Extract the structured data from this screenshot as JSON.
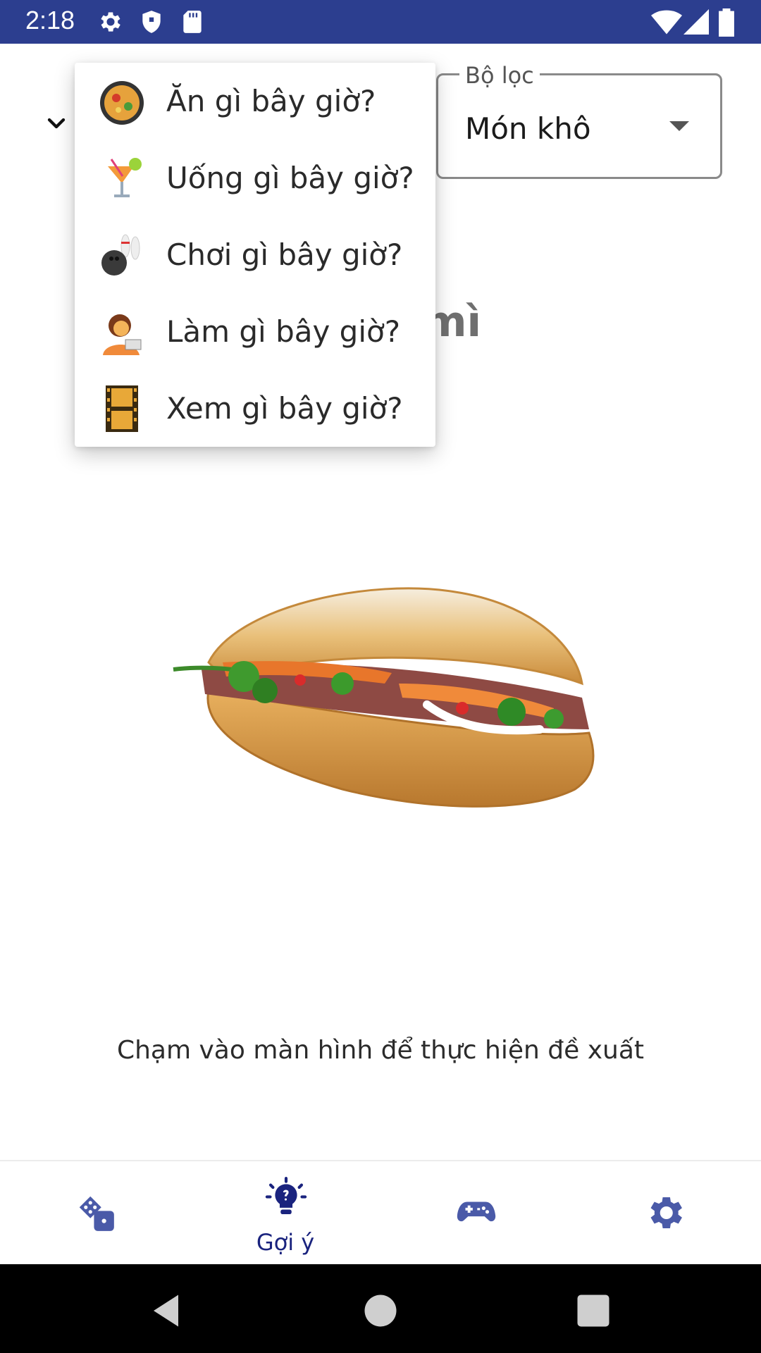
{
  "status_bar": {
    "time": "2:18",
    "bg_color": "#2c3e8f"
  },
  "filter": {
    "label": "Bộ lọc",
    "value": "Món khô"
  },
  "background_title": "mì",
  "menu": {
    "items": [
      {
        "label": "Ăn gì bây giờ?",
        "icon": "paella-pan-icon"
      },
      {
        "label": "Uống gì bây giờ?",
        "icon": "tropical-drink-icon"
      },
      {
        "label": "Chơi gì bây giờ?",
        "icon": "bowling-icon"
      },
      {
        "label": "Làm gì bây giờ?",
        "icon": "artist-person-icon"
      },
      {
        "label": "Xem gì bây giờ?",
        "icon": "film-frames-icon"
      }
    ]
  },
  "hint": "Chạm vào màn hình để thực hiện đề xuất",
  "bottom_nav": {
    "items": [
      {
        "label": "",
        "icon": "dice-icon",
        "active": false
      },
      {
        "label": "Gợi ý",
        "icon": "lightbulb-icon",
        "active": true
      },
      {
        "label": "",
        "icon": "gamepad-icon",
        "active": false
      },
      {
        "label": "",
        "icon": "settings-gear-icon",
        "active": false
      }
    ],
    "active_color": "#1a237e",
    "icon_color": "#4a5aa8"
  }
}
